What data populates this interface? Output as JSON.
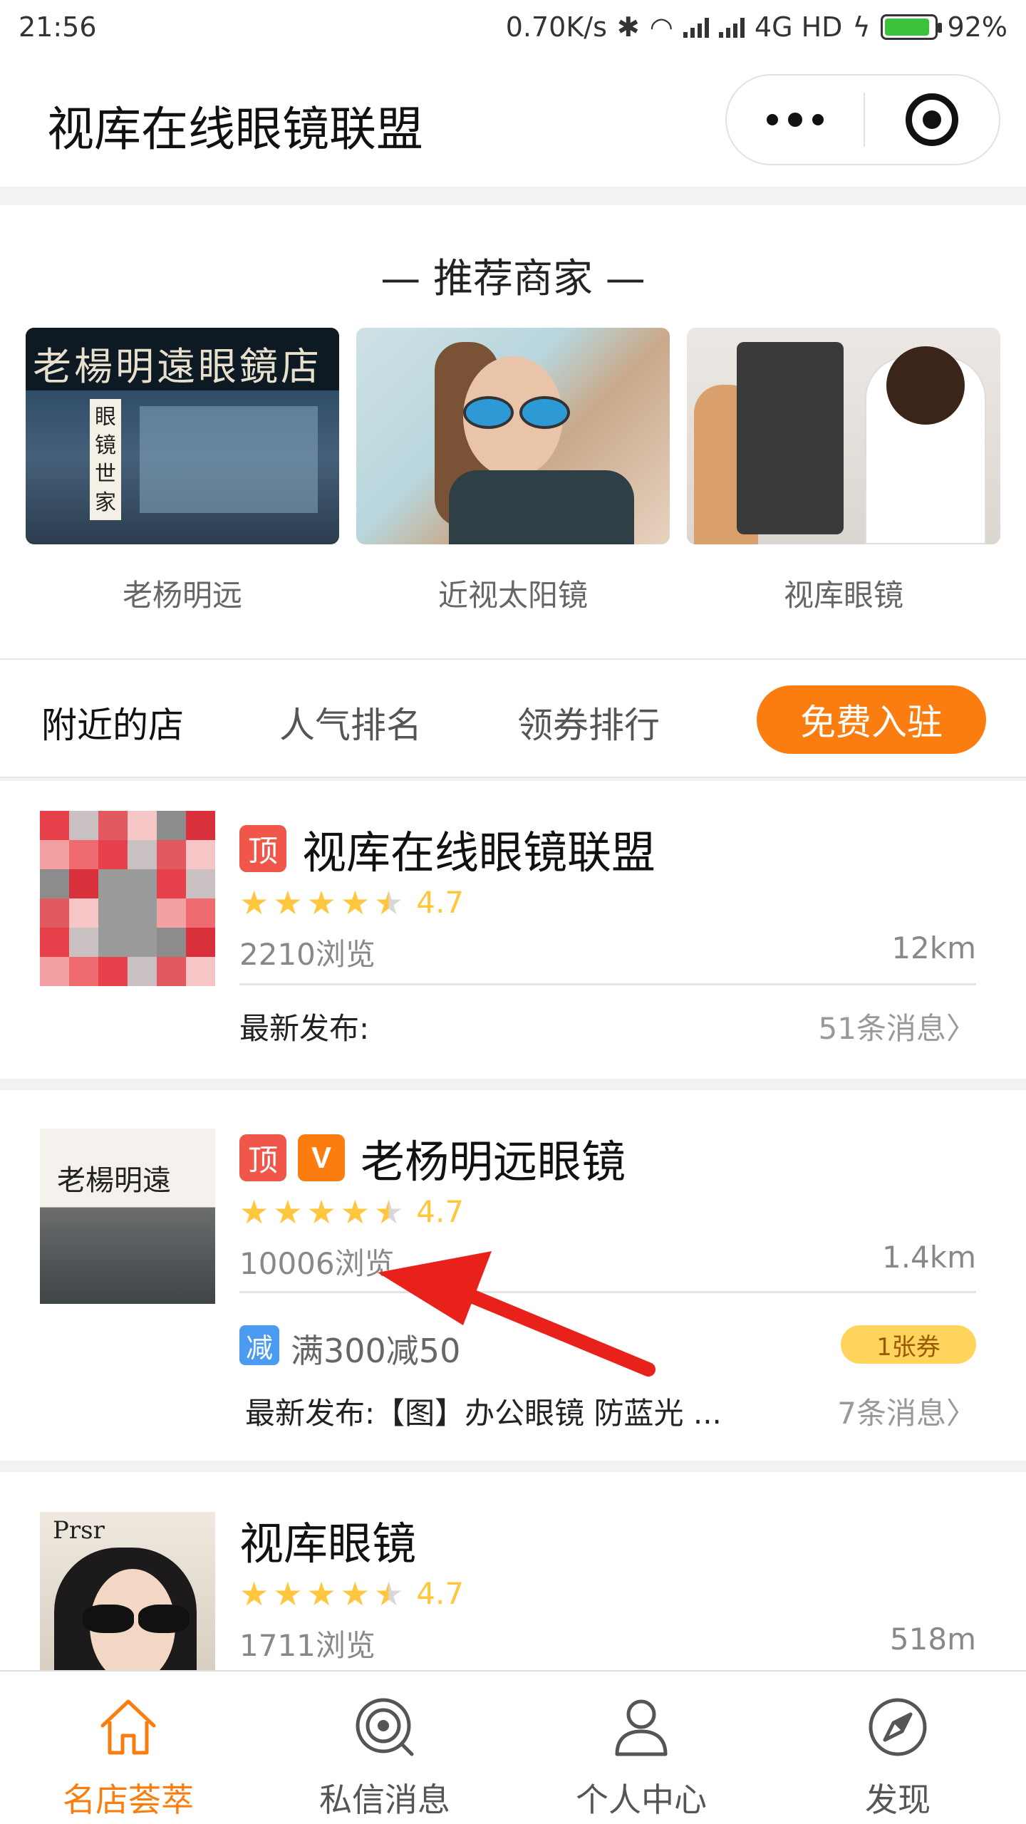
{
  "status_bar": {
    "time": "21:56",
    "speed": "0.70K/s",
    "network": "4G HD",
    "battery": "92%",
    "battery_level": 0.92
  },
  "nav": {
    "title": "视库在线眼镜联盟"
  },
  "recommend": {
    "title": "— 推荐商家 —",
    "items": [
      {
        "name": "老杨明远",
        "sign_text": "老楊明遠眼鏡店",
        "side_sign": "眼镜世家"
      },
      {
        "name": "近视太阳镜"
      },
      {
        "name": "视库眼镜"
      }
    ]
  },
  "tabs": {
    "items": [
      "附近的店",
      "人气排名",
      "领券排行"
    ],
    "join_button": "免费入驻"
  },
  "shops": [
    {
      "name": "视库在线眼镜联盟",
      "badge_top": "顶",
      "rating": "4.7",
      "views": "2210浏览",
      "distance": "12km",
      "latest": "最新发布:",
      "messages": "51条消息",
      "chevron": "〉"
    },
    {
      "name": "老杨明远眼镜",
      "badge_top": "顶",
      "badge_v": "V",
      "thumb_text": "老楊明遠",
      "rating": "4.7",
      "views": "10006浏览",
      "distance": "1.4km",
      "coupon_tag": "减",
      "coupon_text": "满300减50",
      "ticket": "1张券",
      "latest": "最新发布:【图】办公眼镜 防蓝光 ...",
      "messages": "7条消息",
      "chevron": "〉"
    },
    {
      "name": "视库眼镜",
      "thumb_brand": "Prsr",
      "rating": "4.7",
      "views": "1711浏览",
      "distance": "518m"
    }
  ],
  "tabbar": {
    "items": [
      {
        "label": "名店荟萃",
        "icon": "home-icon",
        "active": true
      },
      {
        "label": "私信消息",
        "icon": "message-target-icon",
        "active": false
      },
      {
        "label": "个人中心",
        "icon": "user-icon",
        "active": false
      },
      {
        "label": "发现",
        "icon": "compass-icon",
        "active": false
      }
    ]
  },
  "colors": {
    "accent": "#fb7d10",
    "star": "#ffc63e",
    "badge_red": "#f0574a",
    "coupon_blue": "#4b9cf0",
    "arrow_red": "#e8221b"
  }
}
